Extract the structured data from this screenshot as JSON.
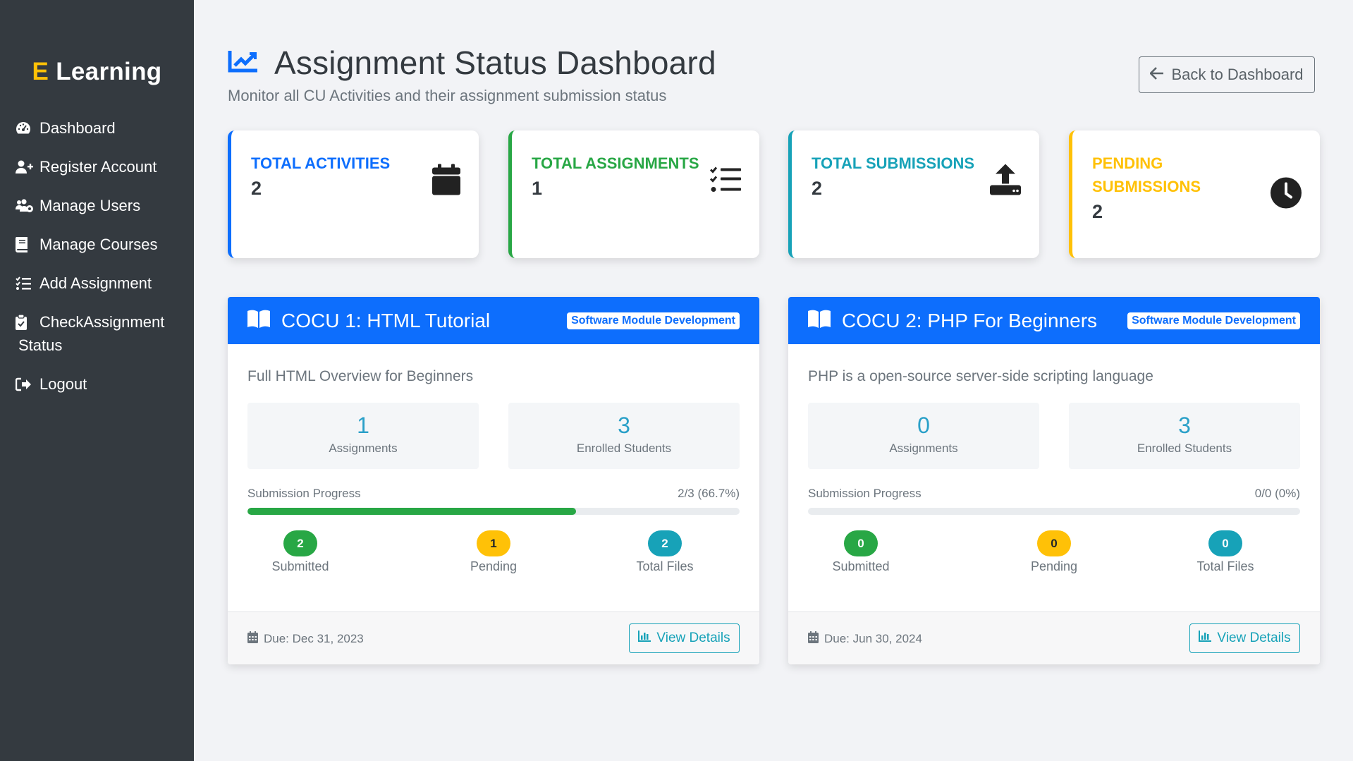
{
  "sidebar": {
    "brand_e": "E",
    "brand_rest": "Learning",
    "items": [
      {
        "label": "Dashboard",
        "icon": "tachometer-icon"
      },
      {
        "label": "Register Account",
        "icon": "user-plus-icon"
      },
      {
        "label": "Manage Users",
        "icon": "users-cog-icon"
      },
      {
        "label": "Manage Courses",
        "icon": "book-icon"
      },
      {
        "label": "Add Assignment",
        "icon": "tasks-icon"
      },
      {
        "label": "CheckAssignment Status",
        "icon": "clipboard-check-icon"
      },
      {
        "label": "Logout",
        "icon": "sign-out-icon"
      }
    ]
  },
  "header": {
    "title": "Assignment Status Dashboard",
    "subtitle": "Monitor all CU Activities and their assignment submission status",
    "back_label": "Back to Dashboard"
  },
  "stats": [
    {
      "label": "Total Activities",
      "value": "2",
      "color": "#0d6efd",
      "icon": "calendar-icon"
    },
    {
      "label": "Total Assignments",
      "value": "1",
      "color": "#28a745",
      "icon": "tasks-list-icon"
    },
    {
      "label": "Total Submissions",
      "value": "2",
      "color": "#17a2b8",
      "icon": "upload-icon"
    },
    {
      "label": "Pending Submissions",
      "value": "2",
      "color": "#ffc107",
      "icon": "clock-icon"
    }
  ],
  "courses": [
    {
      "title": "COCU 1: HTML Tutorial",
      "badge": "Software Module Development",
      "description": "Full HTML Overview for Beginners",
      "assignments": "1",
      "assignments_label": "Assignments",
      "enrolled": "3",
      "enrolled_label": "Enrolled Students",
      "progress_label": "Submission Progress",
      "progress_text": "2/3 (66.7%)",
      "progress_fraction": 0.667,
      "submitted": "2",
      "submitted_label": "Submitted",
      "pending": "1",
      "pending_label": "Pending",
      "files": "2",
      "files_label": "Total Files",
      "due": "Due: Dec 31, 2023",
      "view_label": "View Details"
    },
    {
      "title": "COCU 2: PHP For Beginners",
      "badge": "Software Module Development",
      "description": "PHP is a open-source server-side scripting language",
      "assignments": "0",
      "assignments_label": "Assignments",
      "enrolled": "3",
      "enrolled_label": "Enrolled Students",
      "progress_label": "Submission Progress",
      "progress_text": "0/0 (0%)",
      "progress_fraction": 0,
      "submitted": "0",
      "submitted_label": "Submitted",
      "pending": "0",
      "pending_label": "Pending",
      "files": "0",
      "files_label": "Total Files",
      "due": "Due: Jun 30, 2024",
      "view_label": "View Details"
    }
  ]
}
